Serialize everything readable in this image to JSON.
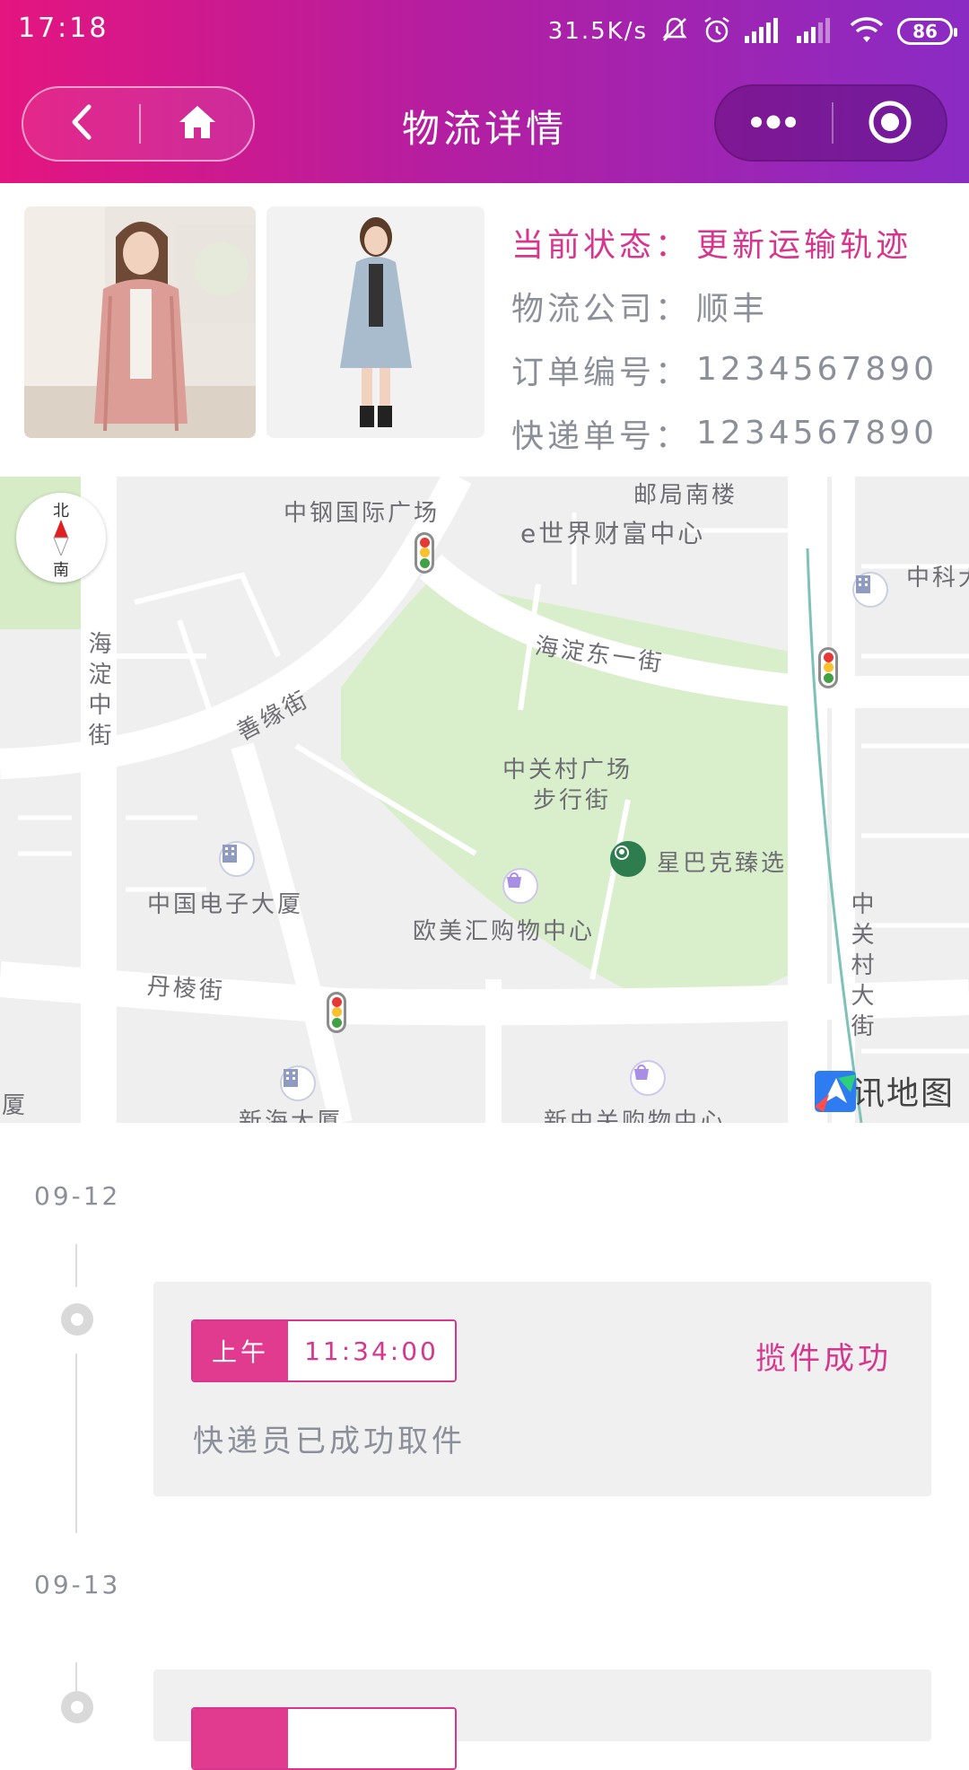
{
  "status_bar": {
    "time": "17:18",
    "net_speed": "31.5K/s",
    "battery": "86"
  },
  "nav": {
    "title": "物流详情"
  },
  "order": {
    "status_label": "当前状态：",
    "status_value": "更新运输轨迹",
    "company_label": "物流公司：",
    "company_value": "顺丰",
    "order_no_label": "订单编号：",
    "order_no_value": "1234567890",
    "tracking_label": "快递单号：",
    "tracking_value": "1234567890"
  },
  "map": {
    "compass_north": "北",
    "compass_south": "南",
    "labels": {
      "zhonggang": "中钢国际广场",
      "post": "邮局南楼",
      "eworld": "e世界财富中心",
      "zhongke": "中科大",
      "haidian_mid": "海淀中街",
      "haidian_east": "海淀东一街",
      "shanyuan": "善缘街",
      "zgc_square": "中关村广场",
      "walk_street": "步行街",
      "starbucks": "星巴克臻选",
      "cec": "中国电子大厦",
      "oumeihui": "欧美汇购物中心",
      "danling": "丹棱街",
      "zgc_street": "中关村大街",
      "sha": "厦",
      "xinhai": "新海大厦",
      "xinzhongguan": "新中关购物中心"
    },
    "brand": "腾讯地图"
  },
  "timeline": [
    {
      "date": "09-12",
      "period": "上午",
      "time": "11:34:00",
      "status": "揽件成功",
      "desc": "快递员已成功取件"
    },
    {
      "date": "09-13"
    }
  ],
  "colors": {
    "accent": "#d6368d",
    "header_start": "#e4157f",
    "header_end": "#8a2bc4"
  }
}
